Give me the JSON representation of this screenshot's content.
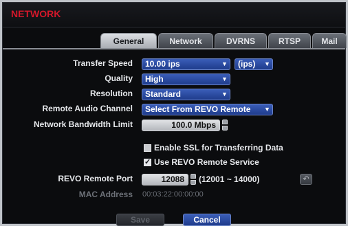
{
  "window": {
    "title": "NETWORK"
  },
  "tabs": [
    {
      "label": "General",
      "active": true
    },
    {
      "label": "Network"
    },
    {
      "label": "DVRNS"
    },
    {
      "label": "RTSP"
    },
    {
      "label": "Mail"
    }
  ],
  "form": {
    "transfer_speed": {
      "label": "Transfer Speed",
      "value": "10.00 ips",
      "unit": "(ips)"
    },
    "quality": {
      "label": "Quality",
      "value": "High"
    },
    "resolution": {
      "label": "Resolution",
      "value": "Standard"
    },
    "remote_audio": {
      "label": "Remote Audio Channel",
      "value": "Select From REVO Remote"
    },
    "bandwidth": {
      "label": "Network Bandwidth Limit",
      "value": "100.0 Mbps"
    },
    "ssl": {
      "label": "Enable SSL for Transferring Data",
      "checked": false
    },
    "revo_service": {
      "label": "Use REVO Remote Service",
      "checked": true
    },
    "revo_port": {
      "label": "REVO Remote Port",
      "value": "12088",
      "range": "(12001 ~ 14000)"
    },
    "mac": {
      "label": "MAC Address",
      "value": "00:03:22:00:00:00"
    }
  },
  "buttons": {
    "save": "Save",
    "cancel": "Cancel"
  },
  "colors": {
    "title": "#d3172a",
    "accent": "#2a4aa3"
  }
}
